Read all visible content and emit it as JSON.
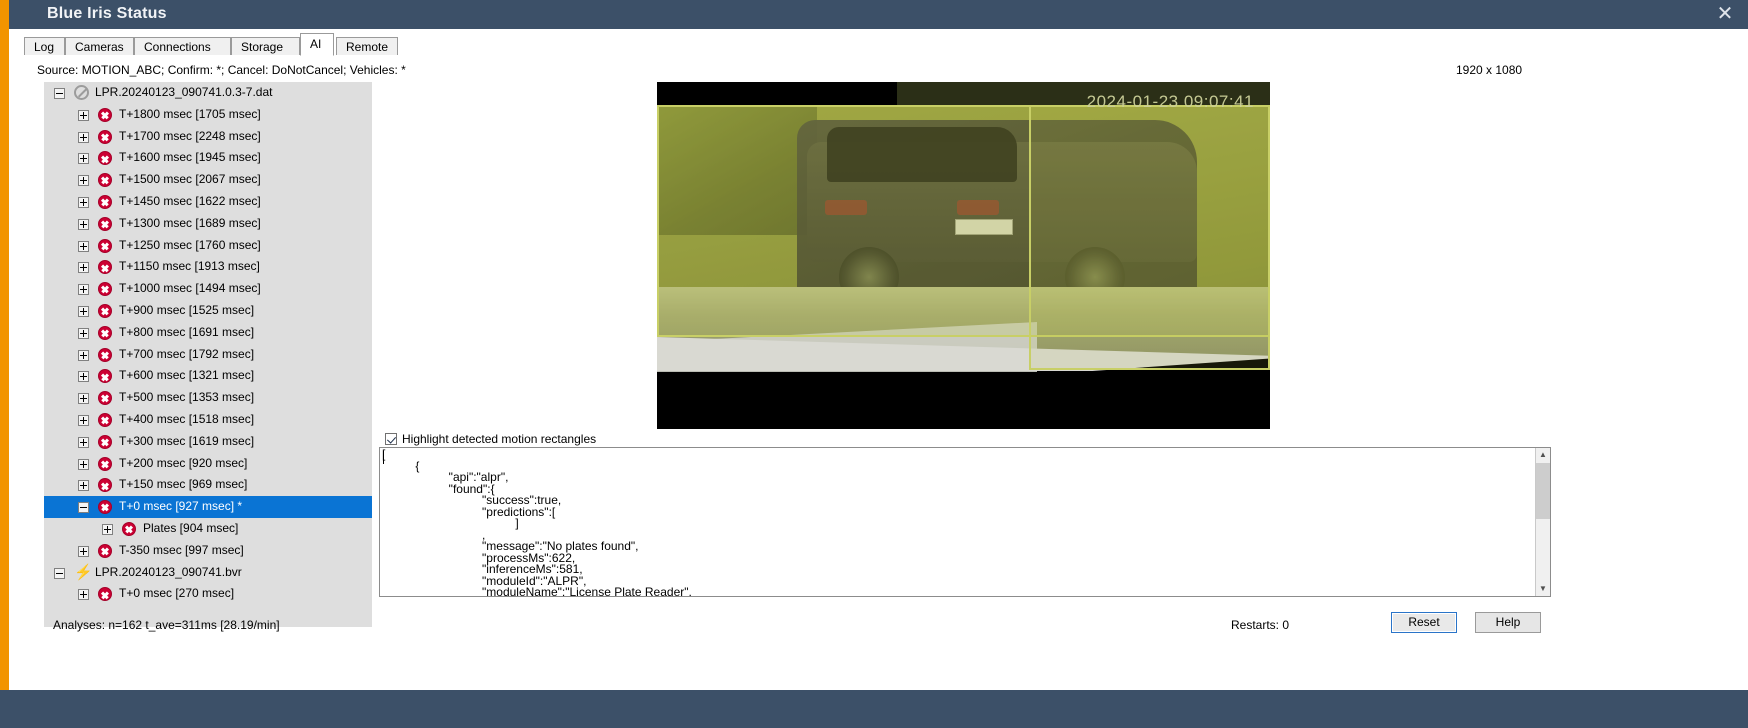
{
  "window": {
    "title": "Blue Iris Status",
    "close_icon": "close-icon"
  },
  "tabs": [
    {
      "label": "Log",
      "active": false
    },
    {
      "label": "Cameras",
      "active": false
    },
    {
      "label": "Connections",
      "active": false
    },
    {
      "label": "Storage",
      "active": false
    },
    {
      "label": "AI",
      "active": true
    },
    {
      "label": "Remote",
      "active": false
    }
  ],
  "header": {
    "source_line": "Source: MOTION_ABC; Confirm: *; Cancel: DoNotCancel; Vehicles: *",
    "resolution": "1920 x 1080"
  },
  "tree": {
    "rows": [
      {
        "depth": 0,
        "expander": "minus",
        "icon": "ban-icon",
        "label": "LPR.20240123_090741.0.3-7.dat",
        "selected": false
      },
      {
        "depth": 1,
        "expander": "plus",
        "icon": "error-icon",
        "label": "T+1800 msec  [1705 msec]",
        "selected": false
      },
      {
        "depth": 1,
        "expander": "plus",
        "icon": "error-icon",
        "label": "T+1700 msec  [2248 msec]",
        "selected": false
      },
      {
        "depth": 1,
        "expander": "plus",
        "icon": "error-icon",
        "label": "T+1600 msec  [1945 msec]",
        "selected": false
      },
      {
        "depth": 1,
        "expander": "plus",
        "icon": "error-icon",
        "label": "T+1500 msec  [2067 msec]",
        "selected": false
      },
      {
        "depth": 1,
        "expander": "plus",
        "icon": "error-icon",
        "label": "T+1450 msec  [1622 msec]",
        "selected": false
      },
      {
        "depth": 1,
        "expander": "plus",
        "icon": "error-icon",
        "label": "T+1300 msec  [1689 msec]",
        "selected": false
      },
      {
        "depth": 1,
        "expander": "plus",
        "icon": "error-icon",
        "label": "T+1250 msec  [1760 msec]",
        "selected": false
      },
      {
        "depth": 1,
        "expander": "plus",
        "icon": "error-icon",
        "label": "T+1150 msec  [1913 msec]",
        "selected": false
      },
      {
        "depth": 1,
        "expander": "plus",
        "icon": "error-icon",
        "label": "T+1000 msec  [1494 msec]",
        "selected": false
      },
      {
        "depth": 1,
        "expander": "plus",
        "icon": "error-icon",
        "label": "T+900 msec  [1525 msec]",
        "selected": false
      },
      {
        "depth": 1,
        "expander": "plus",
        "icon": "error-icon",
        "label": "T+800 msec  [1691 msec]",
        "selected": false
      },
      {
        "depth": 1,
        "expander": "plus",
        "icon": "error-icon",
        "label": "T+700 msec  [1792 msec]",
        "selected": false
      },
      {
        "depth": 1,
        "expander": "plus",
        "icon": "error-icon",
        "label": "T+600 msec  [1321 msec]",
        "selected": false
      },
      {
        "depth": 1,
        "expander": "plus",
        "icon": "error-icon",
        "label": "T+500 msec  [1353 msec]",
        "selected": false
      },
      {
        "depth": 1,
        "expander": "plus",
        "icon": "error-icon",
        "label": "T+400 msec  [1518 msec]",
        "selected": false
      },
      {
        "depth": 1,
        "expander": "plus",
        "icon": "error-icon",
        "label": "T+300 msec  [1619 msec]",
        "selected": false
      },
      {
        "depth": 1,
        "expander": "plus",
        "icon": "error-icon",
        "label": "T+200 msec  [920 msec]",
        "selected": false
      },
      {
        "depth": 1,
        "expander": "plus",
        "icon": "error-icon",
        "label": "T+150 msec  [969 msec]",
        "selected": false
      },
      {
        "depth": 1,
        "expander": "minus",
        "icon": "error-icon",
        "label": "T+0 msec  [927 msec]  *",
        "selected": true
      },
      {
        "depth": 2,
        "expander": "plus",
        "icon": "error-icon",
        "label": "Plates [904 msec]",
        "selected": false
      },
      {
        "depth": 1,
        "expander": "plus",
        "icon": "error-icon",
        "label": "T-350 msec  [997 msec]",
        "selected": false
      },
      {
        "depth": 0,
        "expander": "minus",
        "icon": "bolt-icon",
        "label": "LPR.20240123_090741.bvr",
        "selected": false
      },
      {
        "depth": 1,
        "expander": "plus",
        "icon": "error-icon",
        "label": "T+0 msec  [270 msec]",
        "selected": false
      }
    ]
  },
  "video": {
    "timestamp_overlay": "2024-01-23 09:07:41"
  },
  "options": {
    "highlight_checkbox_label": "Highlight detected motion rectangles",
    "highlight_checked": true
  },
  "json_panel": {
    "content": "[\n          {\n                    \"api\":\"alpr\",\n                    \"found\":{\n                              \"success\":true,\n                              \"predictions\":[\n                                        ]\n                              ,\n                              \"message\":\"No plates found\",\n                              \"processMs\":622,\n                              \"inferenceMs\":581,\n                              \"moduleId\":\"ALPR\",\n                              \"moduleName\":\"License Plate Reader\","
  },
  "status": {
    "analyses": "Analyses:   n=162  t_ave=311ms  [28.19/min]",
    "restarts": "Restarts:   0"
  },
  "buttons": {
    "reset": "Reset",
    "help": "Help"
  },
  "colors": {
    "titlebar": "#3c5068",
    "accent": "#f29400",
    "selection": "#0a74d4",
    "error_icon": "#cc0033",
    "bolt_icon": "#f08000"
  }
}
